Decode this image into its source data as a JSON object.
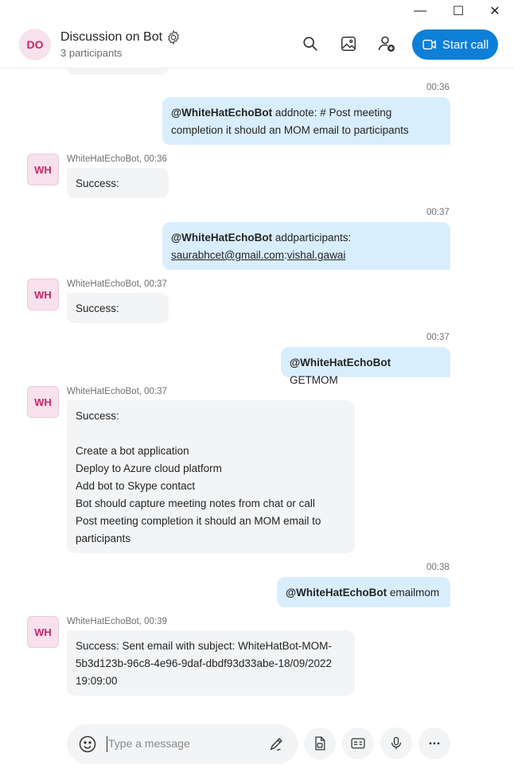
{
  "window_controls": {
    "minimize": "—",
    "maximize": "☐",
    "close": "✕"
  },
  "header": {
    "avatar_initials": "DO",
    "title": "Discussion on Bot",
    "subtitle": "3 participants",
    "start_call_label": "Start call",
    "icons": [
      "settings-icon",
      "search-icon",
      "gallery-icon",
      "add-people-icon",
      "video-icon"
    ]
  },
  "messages": [
    {
      "dir": "out",
      "time": "00:36",
      "mention": "@WhiteHatEchoBot",
      "lines": [
        " addnote: # Post meeting",
        "completion it should an MOM email to participants"
      ]
    },
    {
      "dir": "in",
      "sender": "WhiteHatEchoBot, 00:36",
      "avatar": "WH",
      "lines": [
        "Success:"
      ]
    },
    {
      "dir": "out",
      "time": "00:37",
      "mention": "@WhiteHatEchoBot",
      "lines": [
        " addparticipants:"
      ],
      "link_a": "saurabhcet@gmail.com",
      "link_b": "vishal.gawai"
    },
    {
      "dir": "in",
      "sender": "WhiteHatEchoBot, 00:37",
      "avatar": "WH",
      "lines": [
        "Success:"
      ]
    },
    {
      "dir": "out",
      "time": "00:37",
      "mention": "@WhiteHatEchoBot",
      "lines": [
        " GETMOM"
      ]
    },
    {
      "dir": "in",
      "sender": "WhiteHatEchoBot, 00:37",
      "avatar": "WH",
      "lines": [
        "Success:",
        "",
        "Create a bot application",
        "Deploy to Azure cloud platform",
        "Add bot to Skype contact",
        "Bot should capture meeting notes from chat or call",
        "Post meeting completion it should an MOM email to",
        "participants"
      ]
    },
    {
      "dir": "out",
      "time": "00:38",
      "mention": "@WhiteHatEchoBot",
      "lines": [
        " emailmom"
      ]
    },
    {
      "dir": "in",
      "sender": "WhiteHatEchoBot, 00:39",
      "avatar": "WH",
      "lines": [
        "Success: Sent email with subject: WhiteHatBot-MOM-",
        "5b3d123b-96c8-4e96-9daf-dbdf93d33abe-18/09/2022",
        "19:09:00"
      ]
    }
  ],
  "composer": {
    "placeholder": "Type a message",
    "icons": [
      "emoji-icon",
      "pen-icon",
      "file-icon",
      "contact-card-icon",
      "microphone-icon",
      "more-icon"
    ]
  },
  "colors": {
    "accent": "#0e7fd6",
    "outgoing_bubble": "#d9eefc",
    "incoming_bubble": "#f2f4f6",
    "avatar_bg": "#f6e1ec",
    "avatar_text": "#c4266b"
  }
}
